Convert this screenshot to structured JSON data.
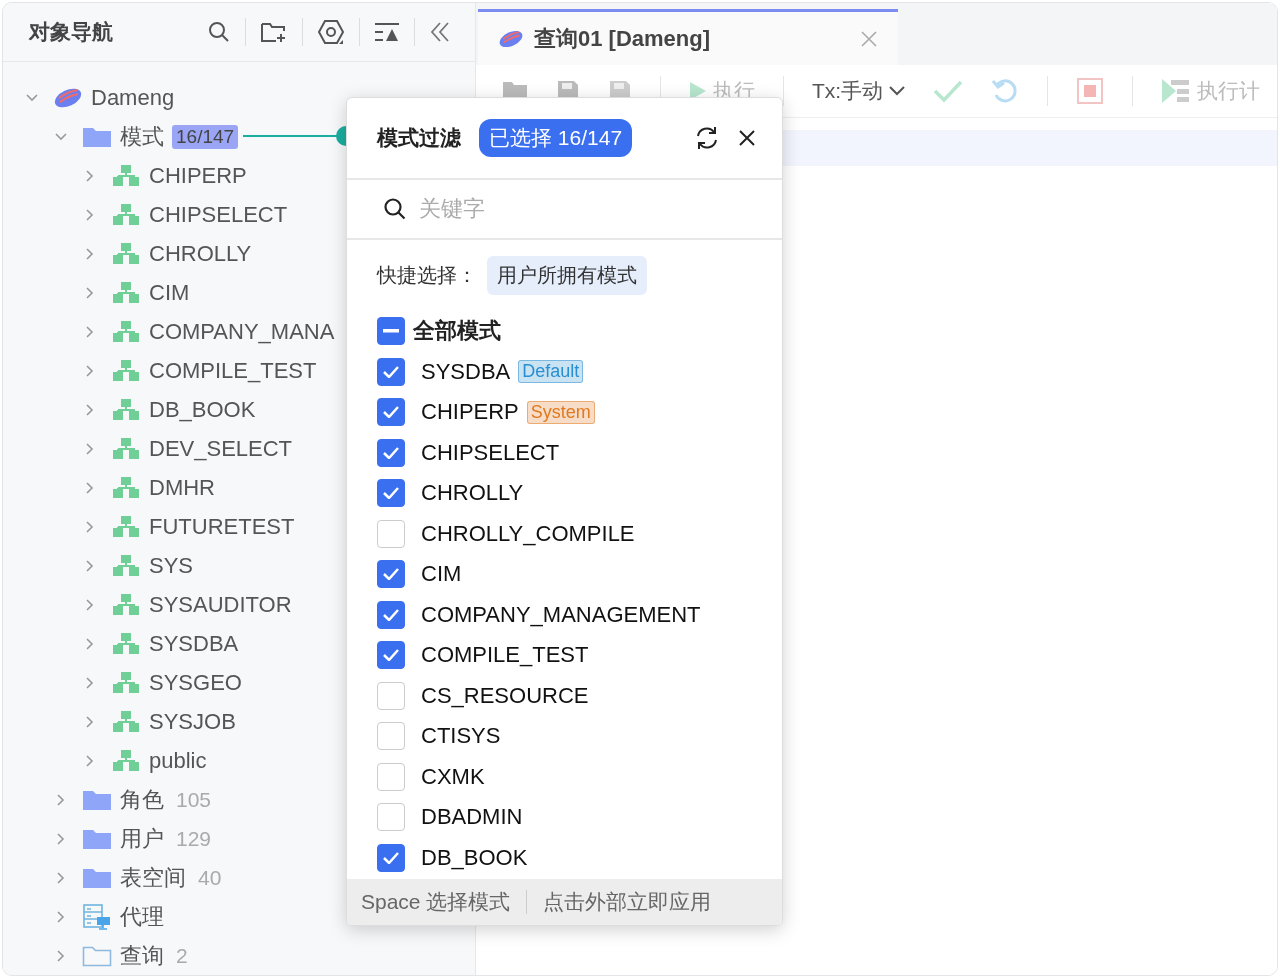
{
  "sidebar": {
    "title": "对象导航",
    "tree": [
      {
        "label": "Dameng",
        "kind": "database",
        "expanded": true,
        "children": [
          {
            "label": "模式",
            "kind": "folder",
            "expanded": true,
            "badge": "16/147",
            "children": [
              {
                "label": "CHIPERP",
                "kind": "schema",
                "expanded": false
              },
              {
                "label": "CHIPSELECT",
                "kind": "schema",
                "expanded": false
              },
              {
                "label": "CHROLLY",
                "kind": "schema",
                "expanded": false
              },
              {
                "label": "CIM",
                "kind": "schema",
                "expanded": false
              },
              {
                "label": "COMPANY_MANA",
                "kind": "schema",
                "expanded": false
              },
              {
                "label": "COMPILE_TEST",
                "kind": "schema",
                "expanded": false
              },
              {
                "label": "DB_BOOK",
                "kind": "schema",
                "expanded": false
              },
              {
                "label": "DEV_SELECT",
                "kind": "schema",
                "expanded": false
              },
              {
                "label": "DMHR",
                "kind": "schema",
                "expanded": false
              },
              {
                "label": "FUTURETEST",
                "kind": "schema",
                "expanded": false
              },
              {
                "label": "SYS",
                "kind": "schema",
                "expanded": false
              },
              {
                "label": "SYSAUDITOR",
                "kind": "schema",
                "expanded": false
              },
              {
                "label": "SYSDBA",
                "kind": "schema",
                "expanded": false
              },
              {
                "label": "SYSGEO",
                "kind": "schema",
                "expanded": false
              },
              {
                "label": "SYSJOB",
                "kind": "schema",
                "expanded": false
              },
              {
                "label": "public",
                "kind": "schema",
                "expanded": false
              }
            ]
          },
          {
            "label": "角色",
            "kind": "folder",
            "expanded": false,
            "count": "105"
          },
          {
            "label": "用户",
            "kind": "folder",
            "expanded": false,
            "count": "129"
          },
          {
            "label": "表空间",
            "kind": "folder",
            "expanded": false,
            "count": "40"
          },
          {
            "label": "代理",
            "kind": "agent",
            "expanded": false
          },
          {
            "label": "查询",
            "kind": "query_folder",
            "expanded": false,
            "count": "2"
          }
        ]
      }
    ]
  },
  "editor": {
    "tabs": [
      {
        "label": "查询01 [Dameng]",
        "selected": true
      }
    ],
    "toolbar": {
      "run_label": "执行",
      "tx_label": "Tx:手动",
      "plan_label": "执行计"
    }
  },
  "schema_filter": {
    "title": "模式过滤",
    "selected_count": "已选择 16/147",
    "search": {
      "placeholder": "关键字"
    },
    "quick_select_label": "快捷选择：",
    "quick_select_option": "用户所拥有模式",
    "select_all": {
      "label": "全部模式",
      "indeterminate": true
    },
    "items": [
      {
        "name": "SYSDBA",
        "checked": true,
        "tag": "Default",
        "color": "#2a8fd0"
      },
      {
        "name": "CHIPERP",
        "checked": true,
        "tag": "System",
        "color": "#e07920"
      },
      {
        "name": "CHIPSELECT",
        "checked": true
      },
      {
        "name": "CHROLLY",
        "checked": true
      },
      {
        "name": "CHROLLY_COMPILE",
        "checked": false
      },
      {
        "name": "CIM",
        "checked": true
      },
      {
        "name": "COMPANY_MANAGEMENT",
        "checked": true
      },
      {
        "name": "COMPILE_TEST",
        "checked": true
      },
      {
        "name": "CS_RESOURCE",
        "checked": false
      },
      {
        "name": "CTISYS",
        "checked": false
      },
      {
        "name": "CXMK",
        "checked": false
      },
      {
        "name": "DBADMIN",
        "checked": false
      },
      {
        "name": "DB_BOOK",
        "checked": true
      }
    ],
    "footer": [
      "Space 选择模式",
      "点击外部立即应用"
    ]
  }
}
